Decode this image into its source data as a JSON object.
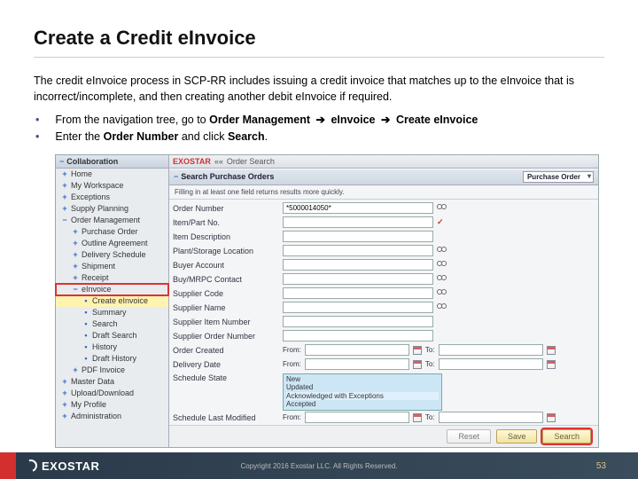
{
  "slide": {
    "title": "Create a Credit eInvoice",
    "intro": "The credit eInvoice process in SCP-RR includes issuing a credit invoice that matches up to the eInvoice that is incorrect/incomplete, and then creating another debit eInvoice if required.",
    "bullet1_pre": "From the navigation tree, go to ",
    "bullet1_b1": "Order Management",
    "bullet1_b2": "eInvoice",
    "bullet1_b3": "Create eInvoice",
    "bullet2_pre": "Enter the ",
    "bullet2_b1": "Order Number",
    "bullet2_mid": " and click ",
    "bullet2_b2": "Search",
    "arrow": "➔"
  },
  "nav": {
    "header": "Collaboration",
    "items": [
      {
        "exp": "+",
        "label": "Home",
        "cls": "level1"
      },
      {
        "exp": "+",
        "label": "My Workspace",
        "cls": "level1"
      },
      {
        "exp": "+",
        "label": "Exceptions",
        "cls": "level1"
      },
      {
        "exp": "+",
        "label": "Supply Planning",
        "cls": "level1"
      },
      {
        "exp": "−",
        "label": "Order Management",
        "cls": "level1"
      },
      {
        "exp": "+",
        "label": "Purchase Order",
        "cls": "level2"
      },
      {
        "exp": "+",
        "label": "Outline Agreement",
        "cls": "level2"
      },
      {
        "exp": "+",
        "label": "Delivery Schedule",
        "cls": "level2"
      },
      {
        "exp": "+",
        "label": "Shipment",
        "cls": "level2"
      },
      {
        "exp": "+",
        "label": "Receipt",
        "cls": "level2"
      },
      {
        "exp": "−",
        "label": "eInvoice",
        "cls": "level2 red-box"
      },
      {
        "exp": "",
        "label": "Create eInvoice",
        "cls": "level3 selected"
      },
      {
        "exp": "",
        "label": "Summary",
        "cls": "level3"
      },
      {
        "exp": "",
        "label": "Search",
        "cls": "level3"
      },
      {
        "exp": "",
        "label": "Draft Search",
        "cls": "level3"
      },
      {
        "exp": "",
        "label": "History",
        "cls": "level3"
      },
      {
        "exp": "",
        "label": "Draft History",
        "cls": "level3"
      },
      {
        "exp": "+",
        "label": "PDF Invoice",
        "cls": "level2"
      },
      {
        "exp": "+",
        "label": "Master Data",
        "cls": "level1"
      },
      {
        "exp": "+",
        "label": "Upload/Download",
        "cls": "level1"
      },
      {
        "exp": "+",
        "label": "My Profile",
        "cls": "level1"
      },
      {
        "exp": "+",
        "label": "Administration",
        "cls": "level1"
      }
    ]
  },
  "main": {
    "top_brand": "EXOSTAR",
    "top_back": "««",
    "top_tab": "Order Search",
    "section_title": "Search Purchase Orders",
    "type_selector": "Purchase Order",
    "hint": "Filling in at least one field returns results more quickly.",
    "fields": {
      "order_number_label": "Order Number",
      "order_number_value": "*5000014050*",
      "item_part_label": "Item/Part No.",
      "item_desc_label": "Item Description",
      "plant_label": "Plant/Storage Location",
      "buyer_label": "Buyer Account",
      "contact_label": "Buy/MRPC Contact",
      "supp_code_label": "Supplier Code",
      "supp_name_label": "Supplier Name",
      "supp_item_label": "Supplier Item Number",
      "supp_order_label": "Supplier Order Number",
      "order_created_label": "Order Created",
      "delivery_label": "Delivery Date",
      "from_label": "From:",
      "to_label": "To:",
      "state_label": "Schedule State",
      "lastmod_label": "Schedule Last Modified",
      "state_opts": [
        "New",
        "Updated",
        "Acknowledged with Exceptions",
        "Accepted"
      ]
    },
    "buttons": {
      "reset": "Reset",
      "save": "Save",
      "search": "Search"
    }
  },
  "footer": {
    "brand": "EXOSTAR",
    "copyright": "Copyright 2016 Exostar LLC. All Rights Reserved.",
    "page": "53"
  }
}
